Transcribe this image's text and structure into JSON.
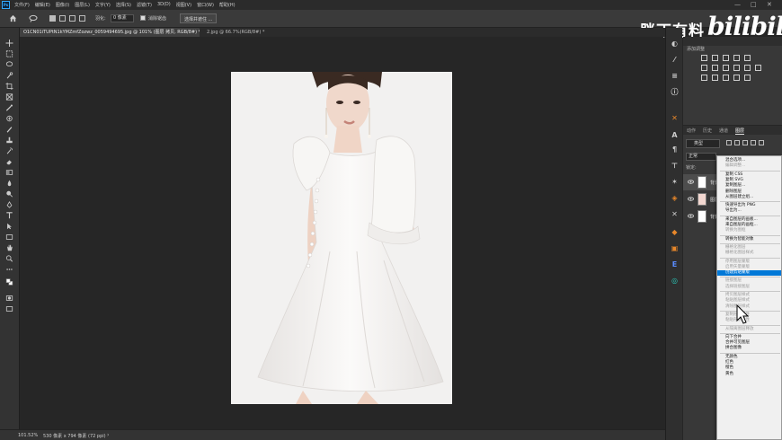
{
  "app": {
    "logo_text": "Ps",
    "menu": [
      "文件(F)",
      "编辑(E)",
      "图像(I)",
      "图层(L)",
      "文字(Y)",
      "选择(S)",
      "滤镜(T)",
      "3D(D)",
      "视图(V)",
      "窗口(W)",
      "帮助(H)"
    ],
    "window_controls": [
      "—",
      "□",
      "✕"
    ]
  },
  "options_bar": {
    "feather_label": "羽化:",
    "feather_value": "0 像素",
    "antialias_label": "消除锯齿",
    "select_mask_button": "选择并遮住 ..."
  },
  "watermark": {
    "text": "胖丁有料",
    "logo_text": "bilibili"
  },
  "tabs": [
    {
      "label": "O1CN01iTUPtN1kYMZmfZozwz_0059494695.jpg @ 101% (图层 拷贝, RGB/8#) *",
      "active": true
    },
    {
      "label": "2.jpg @ 66.7%(RGB/8#) *",
      "active": false
    }
  ],
  "status": {
    "zoom": "101.52%",
    "doc_info": "530 像素 x 794 像素 (72 ppi)",
    "arrow": "›"
  },
  "adjustments_panel": {
    "title": "添加调整"
  },
  "layers_panel": {
    "tabs": [
      "动作",
      "历史",
      "通道",
      "图层"
    ],
    "active_tab": "图层",
    "filter_placeholder": "类型",
    "blend_mode": "正常",
    "lock_label": "锁定:",
    "layers": [
      {
        "name": "背景 拷贝",
        "selected": true
      },
      {
        "name": "图层 1",
        "selected": false
      },
      {
        "name": "背景",
        "selected": false
      }
    ]
  },
  "context_menu": {
    "items": [
      {
        "label": "混合选项...",
        "state": "normal"
      },
      {
        "label": "编辑调整...",
        "state": "disabled"
      },
      {
        "sep": true
      },
      {
        "label": "复制 CSS",
        "state": "normal"
      },
      {
        "label": "复制 SVG",
        "state": "normal"
      },
      {
        "label": "复制图层...",
        "state": "normal"
      },
      {
        "label": "删除图层",
        "state": "normal"
      },
      {
        "label": "从图层建立组...",
        "state": "normal"
      },
      {
        "sep": true
      },
      {
        "label": "快速导出为 PNG",
        "state": "normal"
      },
      {
        "label": "导出为...",
        "state": "normal"
      },
      {
        "sep": true
      },
      {
        "label": "来自图层的画板...",
        "state": "normal"
      },
      {
        "label": "来自图层的画框...",
        "state": "normal"
      },
      {
        "label": "转换为图框",
        "state": "disabled"
      },
      {
        "sep": true
      },
      {
        "label": "转换为智能对象",
        "state": "normal"
      },
      {
        "sep": true
      },
      {
        "label": "栅格化图层",
        "state": "disabled"
      },
      {
        "label": "栅格化图层样式",
        "state": "disabled"
      },
      {
        "sep": true
      },
      {
        "label": "停用图层蒙版",
        "state": "disabled"
      },
      {
        "label": "启用矢量蒙版",
        "state": "disabled"
      },
      {
        "label": "创建剪贴蒙版",
        "state": "highlight"
      },
      {
        "sep": true
      },
      {
        "label": "链接图层",
        "state": "disabled"
      },
      {
        "label": "选择链接图层",
        "state": "disabled"
      },
      {
        "sep": true
      },
      {
        "label": "拷贝图层样式",
        "state": "disabled"
      },
      {
        "label": "粘贴图层样式",
        "state": "disabled"
      },
      {
        "label": "清除图层样式",
        "state": "disabled"
      },
      {
        "sep": true
      },
      {
        "label": "复制形状属性",
        "state": "disabled"
      },
      {
        "label": "粘贴形状属性",
        "state": "disabled"
      },
      {
        "sep": true
      },
      {
        "label": "从隔离图层释放",
        "state": "disabled"
      },
      {
        "sep": true
      },
      {
        "label": "向下合并",
        "state": "normal"
      },
      {
        "label": "合并可见图层",
        "state": "normal"
      },
      {
        "label": "拼合图像",
        "state": "normal"
      },
      {
        "sep": true
      },
      {
        "label": "无颜色",
        "state": "normal"
      },
      {
        "label": "红色",
        "state": "normal"
      },
      {
        "label": "橙色",
        "state": "normal"
      },
      {
        "label": "黄色",
        "state": "normal"
      }
    ]
  },
  "colors": {
    "accent": "#0078d7",
    "canvas_bg": "#262626",
    "panel_bg": "#383838",
    "photo_bg": "#f2f1f0"
  }
}
